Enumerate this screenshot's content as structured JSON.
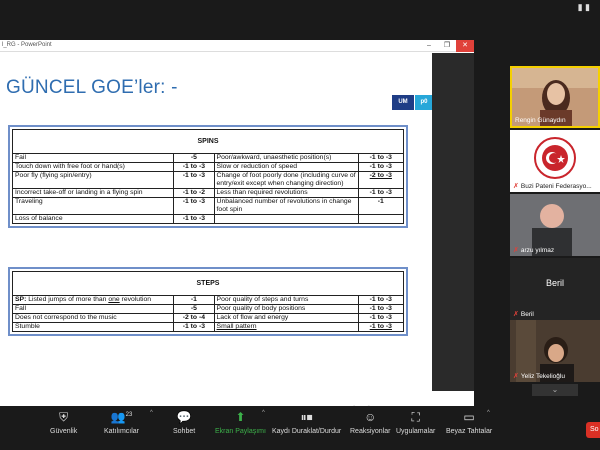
{
  "window": {
    "title": "l_RG - PowerPoint",
    "controls": [
      "–",
      "❐",
      "✕"
    ]
  },
  "slide": {
    "title": "GÜNCEL GOE’ler: -",
    "logo1": "UM",
    "logo2": "p0"
  },
  "spins": {
    "header": "SPINS",
    "rows": [
      {
        "left": "Fail",
        "lv": "-5",
        "right": "Poor/awkward, unaesthetic position(s)",
        "rv": "-1 to -3"
      },
      {
        "left": "Touch down with free foot or hand(s)",
        "lv": "-1 to -3",
        "right": "Slow or reduction of speed",
        "rv": "-1 to -3"
      },
      {
        "left": "Poor fly (flying spin/entry)",
        "lv": "-1 to -3",
        "right": "Change of foot poorly done (including curve of entry/exit except when changing direction)",
        "rv": "-2 to -3"
      },
      {
        "left": "Incorrect take-off or landing in a flying spin",
        "lv": "-1 to -2",
        "right": "Less than required revolutions",
        "rv": "-1 to -3"
      },
      {
        "left": "Traveling",
        "lv": "-1 to -3",
        "right": "Unbalanced number of revolutions in change foot spin",
        "rv": "-1"
      },
      {
        "left": "Loss of balance",
        "lv": "-1 to -3",
        "right": "",
        "rv": ""
      }
    ]
  },
  "steps": {
    "header": "STEPS",
    "row1_left_bold": "SP:",
    "row1_left_a": " Listed jumps of more than ",
    "row1_left_u": "one",
    "row1_left_b": " revolution",
    "row1_lv": "-1",
    "row1_right": "Poor quality of steps and turns",
    "row1_rv": "-1 to -3",
    "rows": [
      {
        "left": "Fall",
        "lv": "-5",
        "right": "Poor quality of body positions",
        "rv": "-1 to -3"
      },
      {
        "left": "Does not correspond to the music",
        "lv": "-2 to -4",
        "right": "Lack of flow and energy",
        "rv": "-1 to -3"
      },
      {
        "left": "Stumble",
        "lv": "-1 to -3",
        "right": "Small pattern",
        "rv": "-1 to -3"
      }
    ]
  },
  "slide_nav": [
    "❮",
    "❯",
    "▤",
    "▦",
    "▥",
    "▣"
  ],
  "participants": [
    {
      "name": "Rengin Günaydın",
      "muted": false
    },
    {
      "name": "Buzi Pateni Federasyo...",
      "muted": true
    },
    {
      "name": "arzu yılmaz",
      "muted": true
    },
    {
      "name": "Beril",
      "muted": true,
      "initial_label": "Beril"
    },
    {
      "name": "Yeliz Tekelioğlu",
      "muted": true
    }
  ],
  "toolbar": {
    "items": [
      {
        "label": "Güvenlik",
        "icon": "shield-icon"
      },
      {
        "label": "Katılımcılar",
        "icon": "participants-icon",
        "count": "23"
      },
      {
        "label": "Sohbet",
        "icon": "chat-icon"
      },
      {
        "label": "Ekran Paylaşımı",
        "icon": "share-screen-icon"
      },
      {
        "label": "Kaydı Duraklat/Durdur",
        "icon": "pause-record-icon"
      },
      {
        "label": "Reaksiyonlar",
        "icon": "reactions-icon"
      },
      {
        "label": "Uygulamalar",
        "icon": "apps-icon"
      },
      {
        "label": "Beyaz Tahtalar",
        "icon": "whiteboard-icon"
      }
    ],
    "end_label": "So"
  },
  "colors": {
    "accent_green": "#3cb14a",
    "title_blue": "#2f6db0",
    "active_speaker": "#f5d000",
    "mute_red": "#e0413a"
  }
}
